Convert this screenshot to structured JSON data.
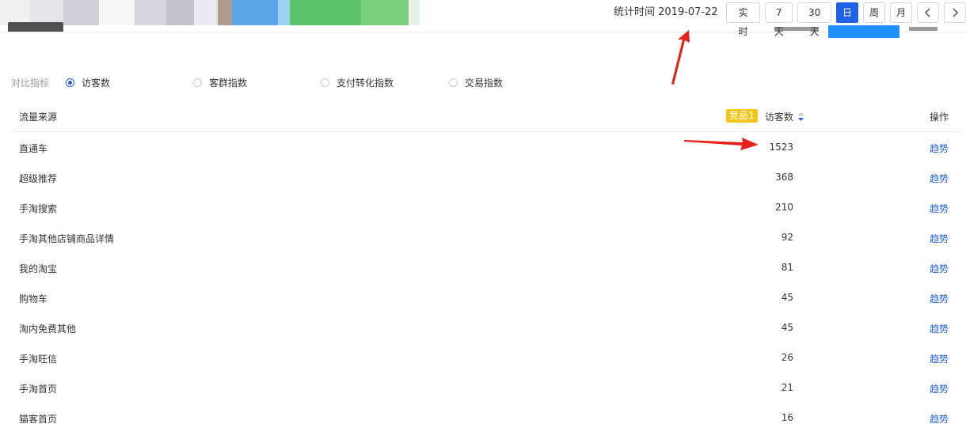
{
  "header": {
    "stat_time_label": "统计时间 2019-07-22",
    "periods": [
      {
        "label": "实 时",
        "active": false
      },
      {
        "label": "7天",
        "active": false
      },
      {
        "label": "30天",
        "active": false
      },
      {
        "label": "日",
        "active": true
      },
      {
        "label": "周",
        "active": false
      },
      {
        "label": "月",
        "active": false
      }
    ],
    "prev_icon": "chevron-left-icon",
    "next_icon": "chevron-right-icon"
  },
  "metrics": {
    "label": "对比指标",
    "options": [
      {
        "label": "访客数",
        "checked": true
      },
      {
        "label": "客群指数",
        "checked": false
      },
      {
        "label": "支付转化指数",
        "checked": false
      },
      {
        "label": "交易指数",
        "checked": false
      }
    ]
  },
  "table": {
    "col_source": "流量来源",
    "badge": "竞品1",
    "col_visitors": "访客数",
    "col_action": "操作",
    "rows": [
      {
        "source": "直通车",
        "visitors": "1523",
        "action": "趋势"
      },
      {
        "source": "超级推荐",
        "visitors": "368",
        "action": "趋势"
      },
      {
        "source": "手淘搜索",
        "visitors": "210",
        "action": "趋势"
      },
      {
        "source": "手淘其他店铺商品详情",
        "visitors": "92",
        "action": "趋势"
      },
      {
        "source": "我的淘宝",
        "visitors": "81",
        "action": "趋势"
      },
      {
        "source": "购物车",
        "visitors": "45",
        "action": "趋势"
      },
      {
        "source": "淘内免费其他",
        "visitors": "45",
        "action": "趋势"
      },
      {
        "source": "手淘旺信",
        "visitors": "26",
        "action": "趋势"
      },
      {
        "source": "手淘首页",
        "visitors": "21",
        "action": "趋势"
      },
      {
        "source": "猫客首页",
        "visitors": "16",
        "action": "趋势"
      }
    ]
  },
  "colors": {
    "accent": "#2062e6",
    "badge": "#f5c518",
    "annotation": "#e8211a"
  }
}
